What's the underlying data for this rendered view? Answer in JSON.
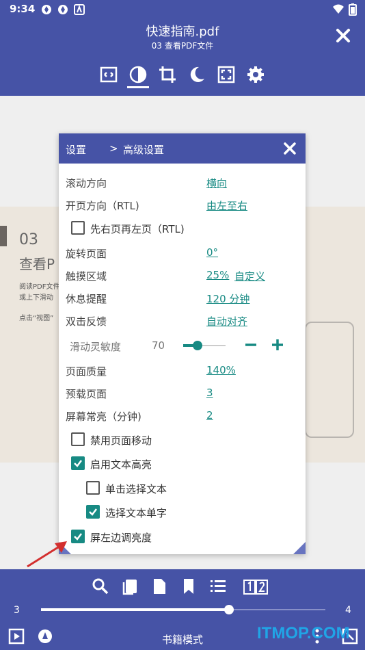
{
  "status": {
    "time": "9:34"
  },
  "header": {
    "title": "快速指南.pdf",
    "subtitle": "03 查看PDF文件"
  },
  "toolbar": {
    "icons": [
      "crop-fit-icon",
      "contrast-icon",
      "crop-icon",
      "night-mode-icon",
      "fullscreen-icon",
      "settings-icon"
    ]
  },
  "page": {
    "number": "03",
    "heading": "查看P",
    "line1": "阅读PDF文件",
    "line2": "或上下滑动",
    "line3": "点击“视图”"
  },
  "dialog": {
    "crumb_settings": "设置",
    "crumb_sep": ">",
    "crumb_advanced": "高级设置",
    "rows": {
      "scroll_direction": {
        "label": "滚动方向",
        "value": "横向"
      },
      "page_direction": {
        "label": "开页方向（RTL)",
        "value": "由左至右"
      },
      "right_first": {
        "label": "先右页再左页（RTL)",
        "checked": false
      },
      "rotate": {
        "label": "旋转页面",
        "value": "0°"
      },
      "touch_area": {
        "label": "触摸区域",
        "value": "25%",
        "value2": "自定义"
      },
      "rest_reminder": {
        "label": "休息提醒",
        "value": "120 分钟"
      },
      "double_tap": {
        "label": "双击反馈",
        "value": "自动对齐"
      },
      "sensitivity": {
        "label": "滑动灵敏度",
        "value": "70"
      },
      "quality": {
        "label": "页面质量",
        "value": "140%"
      },
      "preload": {
        "label": "预载页面",
        "value": "3"
      },
      "screen_on": {
        "label": "屏幕常亮（分钟)",
        "value": "2"
      },
      "disable_move": {
        "label": "禁用页面移动",
        "checked": false
      },
      "text_highlight": {
        "label": "启用文本高亮",
        "checked": true
      },
      "single_tap_select": {
        "label": "单击选择文本",
        "checked": false
      },
      "select_word": {
        "label": "选择文本单字",
        "checked": true
      },
      "left_brightness": {
        "label": "屏左边调亮度",
        "checked": true
      }
    }
  },
  "bottom": {
    "page_start": "3",
    "page_end": "4",
    "progress": 0.66,
    "mode_label": "书籍模式",
    "icons": [
      "search-icon",
      "copy-icon",
      "document-icon",
      "bookmark-icon",
      "list-icon",
      "two-page-icon"
    ]
  },
  "watermark": "ITMOP.COM",
  "colors": {
    "primary": "#4653a6",
    "accent": "#178a83",
    "arrow": "#d32f2f"
  }
}
